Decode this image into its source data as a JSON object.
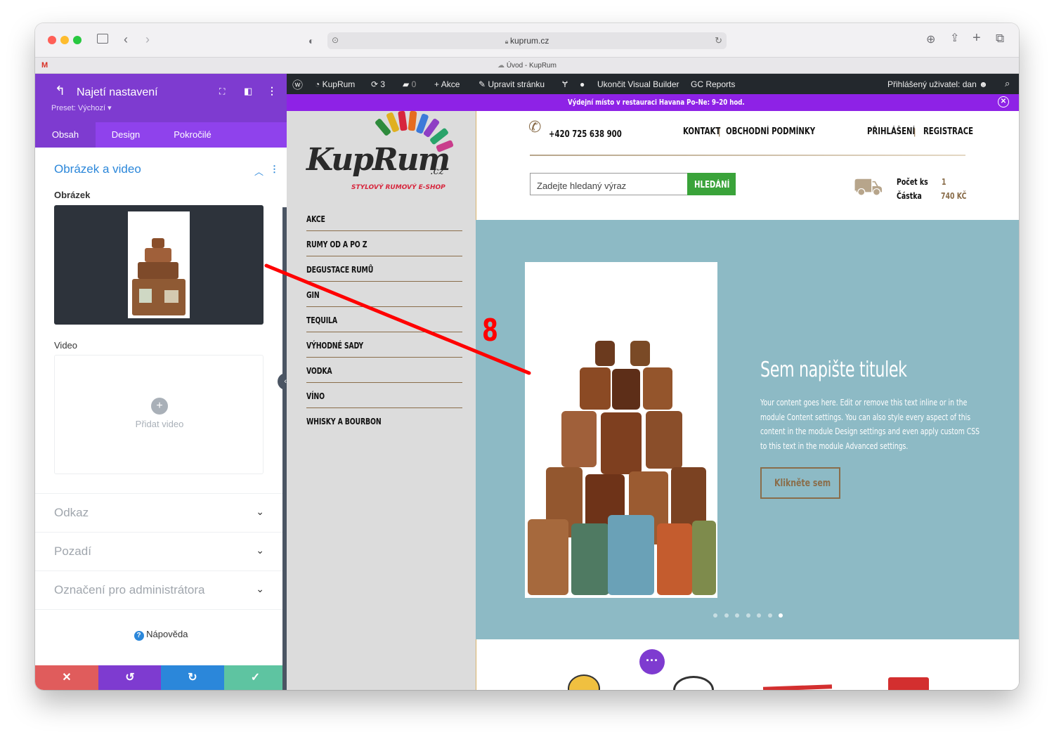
{
  "browser": {
    "url": "kuprum.cz",
    "tab_title": "Úvod - KupRum"
  },
  "divi_panel": {
    "title": "Najetí nastavení",
    "preset": "Preset: Výchozí ▾",
    "tabs": [
      "Obsah",
      "Design",
      "Pokročilé"
    ],
    "section_title": "Obrázek a video",
    "image_label": "Obrázek",
    "video_label": "Video",
    "add_video": "Přidat video",
    "collapsed": [
      "Odkaz",
      "Pozadí",
      "Označení pro administrátora"
    ],
    "help": "Nápověda",
    "colors": {
      "header": "#7e3bd0",
      "tabs": "#8f42ec",
      "accent": "#2b87da",
      "cancel": "#e05c5c",
      "undo": "#7e3bd0",
      "redo": "#2b87da",
      "save": "#5ec4a1"
    }
  },
  "wp_admin_bar": {
    "site": "KupRum",
    "updates": "3",
    "comments": "0",
    "new": "Akce",
    "edit": "Upravit stránku",
    "exit_builder": "Ukončit Visual Builder",
    "gc": "GC Reports",
    "user": "Přihlášený uživatel: dan"
  },
  "promo_bar": "Výdejní místo v restauraci Havana Po–Ne: 9–20 hod.",
  "site": {
    "logo_text": "KupRum",
    "logo_tld": ".cz",
    "logo_tagline": "STYLOVÝ RUMOVÝ E-SHOP",
    "phone": "+420 725 638 900",
    "links_left": [
      "KONTAKT",
      "OBCHODNÍ PODMÍNKY"
    ],
    "links_right": [
      "PŘIHLÁŠENÍ",
      "REGISTRACE"
    ],
    "search_placeholder": "Zadejte hledaný výraz",
    "search_button": "HLEDÁNÍ",
    "cart_count_label": "Počet ks",
    "cart_count": "1",
    "cart_sum_label": "Částka",
    "cart_sum": "740 KČ",
    "menu": [
      "AKCE",
      "RUMY OD A PO Z",
      "DEGUSTACE RUMŮ",
      "GIN",
      "TEQUILA",
      "VÝHODNÉ SADY",
      "VODKA",
      "VÍNO",
      "WHISKY A BOURBON"
    ]
  },
  "hero": {
    "title": "Sem napište titulek",
    "body": "Your content goes here. Edit or remove this text inline or in the module Content settings. You can also style every aspect of this content in the module Design settings and even apply custom CSS to this text in the module Advanced settings.",
    "button": "Klikněte sem",
    "slides": 7,
    "active_slide": 7,
    "bg_color": "#8dbac5"
  },
  "annotation": {
    "number": "8",
    "color": "#ff0000"
  }
}
